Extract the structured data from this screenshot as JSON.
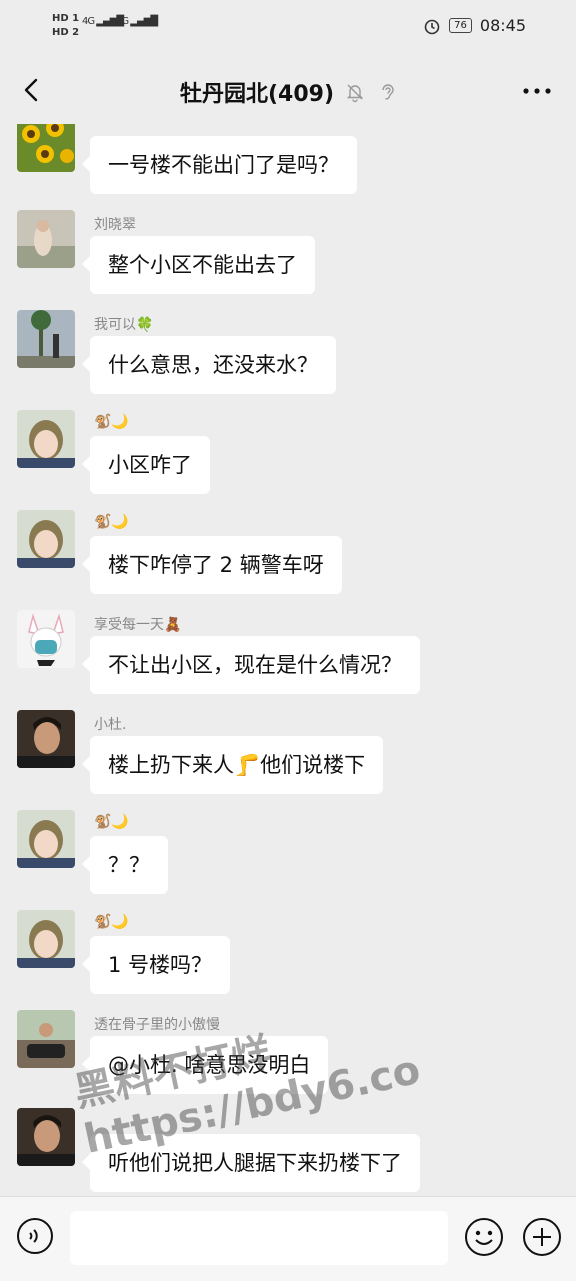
{
  "status": {
    "hd1": "HD 1",
    "hd2": "HD 2",
    "signal1": "4G",
    "signal2": "4G",
    "battery": "76",
    "time": "08:45"
  },
  "header": {
    "title": "牡丹园北(409)"
  },
  "messages": [
    {
      "sender": "",
      "text": "一号楼不能出门了是吗？"
    },
    {
      "sender": "刘晓翠",
      "text": "整个小区不能出去了"
    },
    {
      "sender": "我可以🍀",
      "text": "什么意思，还没来水？"
    },
    {
      "sender": "🐒🌙",
      "text": "小区咋了"
    },
    {
      "sender": "🐒🌙",
      "text": "楼下咋停了 2 辆警车呀"
    },
    {
      "sender": "享受每一天🧸",
      "text": "不让出小区，现在是什么情况？"
    },
    {
      "sender": "小杜.",
      "text": "楼上扔下来人🦵他们说楼下"
    },
    {
      "sender": "🐒🌙",
      "text": "？？"
    },
    {
      "sender": "🐒🌙",
      "text": "1 号楼吗？"
    },
    {
      "sender": "透在骨子里的小傲慢",
      "text": "@小杜. 啥意思没明白"
    },
    {
      "sender": "",
      "text": "听他们说把人腿据下来扔楼下了"
    }
  ],
  "watermark": {
    "line1": "黑料不打烊",
    "line2": "https://bdy6.co"
  },
  "colors": {
    "background": "#ededed",
    "bubble": "#ffffff",
    "sender": "#888888"
  }
}
